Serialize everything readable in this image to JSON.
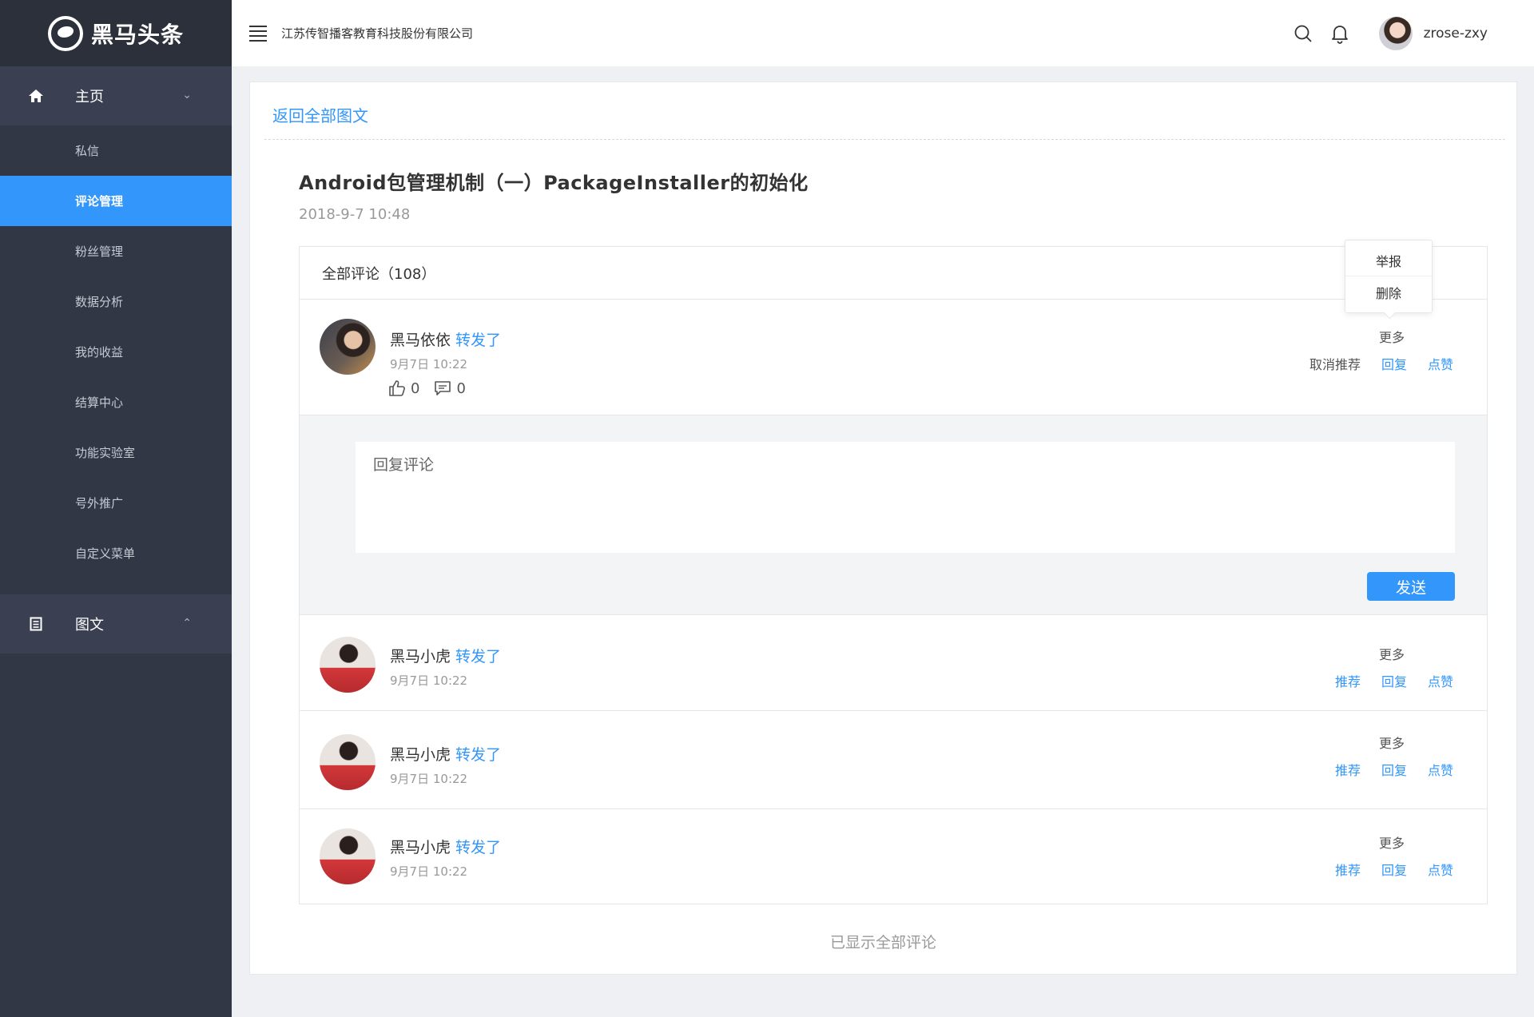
{
  "brand": {
    "name": "黑马头条"
  },
  "sidebar": {
    "home": {
      "label": "主页",
      "chevron": "⌄"
    },
    "items": [
      {
        "label": "私信"
      },
      {
        "label": "评论管理"
      },
      {
        "label": "粉丝管理"
      },
      {
        "label": "数据分析"
      },
      {
        "label": "我的收益"
      },
      {
        "label": "结算中心"
      },
      {
        "label": "功能实验室"
      },
      {
        "label": "号外推广"
      },
      {
        "label": "自定义菜单"
      }
    ],
    "articles": {
      "label": "图文",
      "chevron": "⌃"
    },
    "active_item": "评论管理"
  },
  "header": {
    "company": "江苏传智播客教育科技股份有限公司",
    "username": "zrose-zxy",
    "icons": [
      "menu-icon",
      "search-icon",
      "bell-icon"
    ]
  },
  "main": {
    "back_link": "返回全部图文",
    "article_title": "Android包管理机制（一）PackageInstaller的初始化",
    "article_date": "2018-9-7 10:48",
    "comments_header": "全部评论（108）",
    "popover": {
      "report": "举报",
      "delete": "删除"
    },
    "comments": [
      {
        "name": "黑马依依",
        "action": "转发了",
        "time": "9月7日 10:22",
        "likes": "0",
        "replies": "0",
        "more": "更多",
        "recommend": "取消推荐",
        "reply": "回复",
        "like": "点赞"
      },
      {
        "name": "黑马小虎",
        "action": "转发了",
        "time": "9月7日 10:22",
        "more": "更多",
        "recommend": "推荐",
        "reply": "回复",
        "like": "点赞"
      },
      {
        "name": "黑马小虎",
        "action": "转发了",
        "time": "9月7日 10:22",
        "more": "更多",
        "recommend": "推荐",
        "reply": "回复",
        "like": "点赞"
      },
      {
        "name": "黑马小虎",
        "action": "转发了",
        "time": "9月7日 10:22",
        "more": "更多",
        "recommend": "推荐",
        "reply": "回复",
        "like": "点赞"
      }
    ],
    "reply_box": {
      "placeholder": "回复评论",
      "send": "发送"
    },
    "footer": "已显示全部评论"
  },
  "colors": {
    "accent": "#3296fa",
    "sidebar_bg": "#323745",
    "sidebar_header_bg": "#2b303b"
  }
}
